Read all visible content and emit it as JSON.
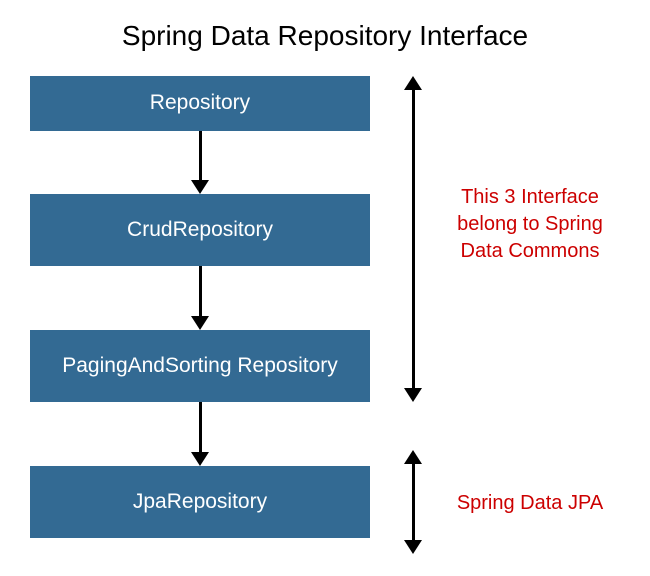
{
  "title": "Spring Data Repository Interface",
  "boxes": {
    "b1": "Repository",
    "b2": "CrudRepository",
    "b3": "PagingAndSorting Repository",
    "b4": "JpaRepository"
  },
  "annotations": {
    "a1": "This 3 Interface belong to Spring Data Commons",
    "a2": "Spring Data JPA"
  },
  "colors": {
    "box_bg": "#336a93",
    "box_fg": "#ffffff",
    "annotation_fg": "#cc0000"
  }
}
